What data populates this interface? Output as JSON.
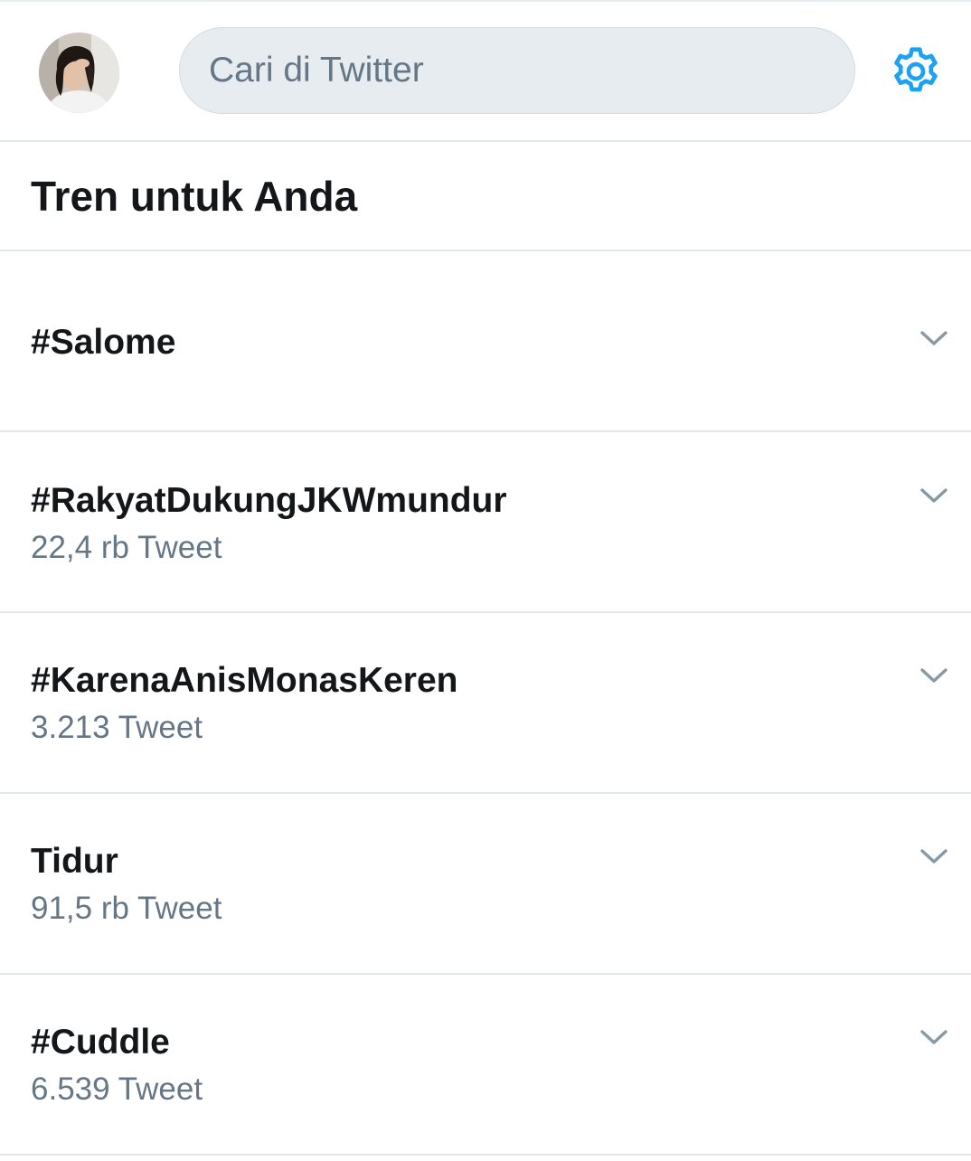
{
  "search": {
    "placeholder": "Cari di Twitter"
  },
  "icons": {
    "settings": "gear-icon",
    "caret": "chevron-down-icon"
  },
  "colors": {
    "accent": "#1da1f2",
    "text_primary": "#14171a",
    "text_secondary": "#657786",
    "divider": "#e1e8ed",
    "search_bg": "#e6ecf0"
  },
  "section": {
    "title": "Tren untuk Anda"
  },
  "trends": [
    {
      "name": "#Salome",
      "count": ""
    },
    {
      "name": "#RakyatDukungJKWmundur",
      "count": "22,4 rb Tweet"
    },
    {
      "name": "#KarenaAnisMonasKeren",
      "count": "3.213 Tweet"
    },
    {
      "name": "Tidur",
      "count": "91,5 rb Tweet"
    },
    {
      "name": "#Cuddle",
      "count": "6.539 Tweet"
    }
  ]
}
